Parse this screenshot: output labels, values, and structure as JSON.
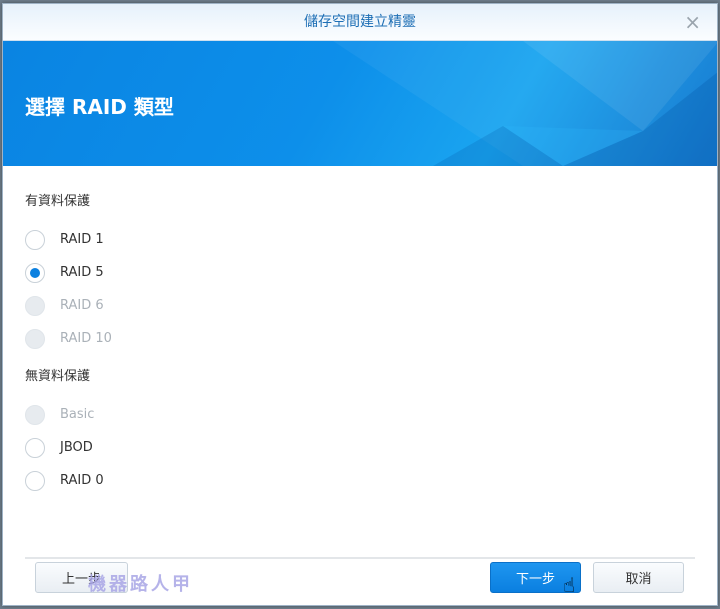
{
  "window": {
    "title": "儲存空間建立精靈",
    "close": "×"
  },
  "banner": {
    "heading": "選擇 RAID 類型"
  },
  "groups": [
    {
      "label": "有資料保護",
      "options": [
        {
          "label": "RAID 1",
          "selected": false,
          "disabled": false
        },
        {
          "label": "RAID 5",
          "selected": true,
          "disabled": false
        },
        {
          "label": "RAID 6",
          "selected": false,
          "disabled": true
        },
        {
          "label": "RAID 10",
          "selected": false,
          "disabled": true
        }
      ]
    },
    {
      "label": "無資料保護",
      "options": [
        {
          "label": "Basic",
          "selected": false,
          "disabled": true
        },
        {
          "label": "JBOD",
          "selected": false,
          "disabled": false
        },
        {
          "label": "RAID 0",
          "selected": false,
          "disabled": false
        }
      ]
    }
  ],
  "buttons": {
    "back": "上一步",
    "next": "下一步",
    "cancel": "取消"
  },
  "watermark": "機器路人甲",
  "colors": {
    "accent": "#0b80e0"
  }
}
